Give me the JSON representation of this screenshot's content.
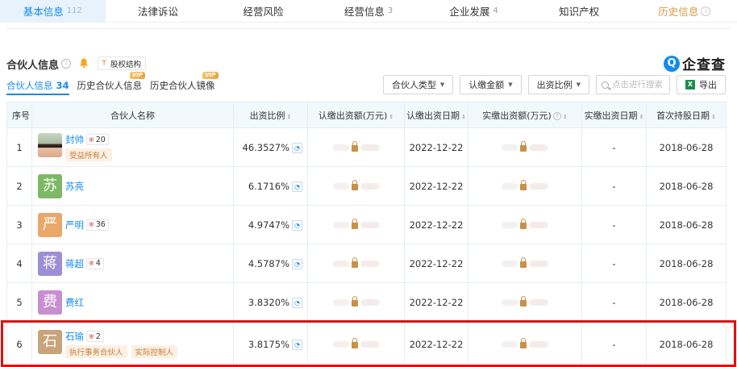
{
  "top_tabs": [
    {
      "label": "基本信息",
      "count": "112"
    },
    {
      "label": "法律诉讼",
      "count": ""
    },
    {
      "label": "经营风险",
      "count": ""
    },
    {
      "label": "经营信息",
      "count": "3"
    },
    {
      "label": "企业发展",
      "count": "4"
    },
    {
      "label": "知识产权",
      "count": ""
    },
    {
      "label": "历史信息",
      "count": ""
    }
  ],
  "section": {
    "title": "合伙人信息",
    "equity_btn": "股权结构",
    "brand": "企查查",
    "brand_logo": "Q"
  },
  "subtabs": [
    {
      "label": "合伙人信息",
      "count": "34"
    },
    {
      "label": "历史合伙人信息",
      "vip": "VIP"
    },
    {
      "label": "历史合伙人镜像",
      "vip": "VIP"
    }
  ],
  "filters": {
    "partner_type": "合伙人类型",
    "subscribed_amount": "认缴金额",
    "ratio": "出资比例",
    "search_placeholder": "点击进行搜索",
    "export": "导出"
  },
  "columns": [
    "序号",
    "合伙人名称",
    "出资比例",
    "认缴出资额(万元)",
    "认缴出资日期",
    "实缴出资额(万元)",
    "实缴出资日期",
    "首次持股日期"
  ],
  "rows": [
    {
      "seq": "1",
      "avatar_char": "",
      "avatar_color": "",
      "photo": true,
      "name": "封帅",
      "rel_count": "20",
      "tags": [
        "受益所有人"
      ],
      "ratio": "46.3527%",
      "sub_date": "2022-12-22",
      "paid_date": "-",
      "first_date": "2018-06-28"
    },
    {
      "seq": "2",
      "avatar_char": "苏",
      "avatar_color": "#7cb865",
      "photo": false,
      "name": "苏亮",
      "rel_count": "",
      "tags": [],
      "ratio": "6.1716%",
      "sub_date": "2022-12-22",
      "paid_date": "-",
      "first_date": "2018-06-28"
    },
    {
      "seq": "3",
      "avatar_char": "严",
      "avatar_color": "#e8a86a",
      "photo": false,
      "name": "严明",
      "rel_count": "36",
      "tags": [],
      "ratio": "4.9747%",
      "sub_date": "2022-12-22",
      "paid_date": "-",
      "first_date": "2018-06-28"
    },
    {
      "seq": "4",
      "avatar_char": "蒋",
      "avatar_color": "#9c8fd6",
      "photo": false,
      "name": "蒋超",
      "rel_count": "4",
      "tags": [],
      "ratio": "4.5787%",
      "sub_date": "2022-12-22",
      "paid_date": "-",
      "first_date": "2018-06-28"
    },
    {
      "seq": "5",
      "avatar_char": "费",
      "avatar_color": "#c88fd0",
      "photo": false,
      "name": "费红",
      "rel_count": "",
      "tags": [],
      "ratio": "3.8320%",
      "sub_date": "2022-12-22",
      "paid_date": "-",
      "first_date": "2018-06-28"
    },
    {
      "seq": "6",
      "avatar_char": "石",
      "avatar_color": "#c9a37a",
      "photo": false,
      "name": "石瑜",
      "rel_count": "2",
      "tags": [
        "执行事务合伙人",
        "实际控制人"
      ],
      "ratio": "3.8175%",
      "sub_date": "2022-12-22",
      "paid_date": "-",
      "first_date": "2018-06-28"
    }
  ],
  "colors": {
    "accent": "#128bed",
    "highlight_border": "#e01010",
    "tag_bg": "#fdf0e3",
    "tag_text": "#c17b35"
  }
}
